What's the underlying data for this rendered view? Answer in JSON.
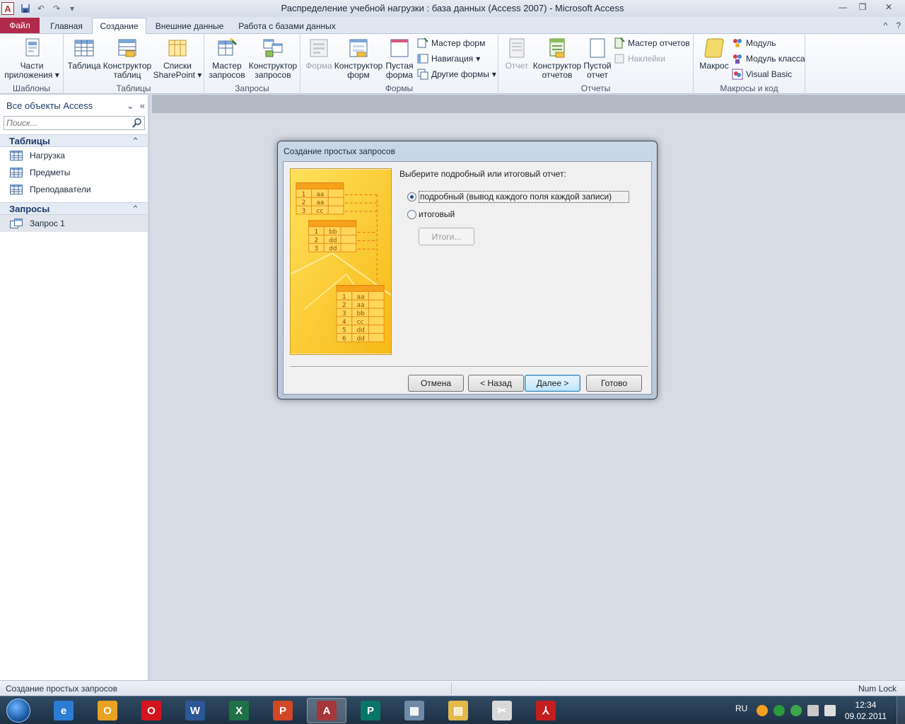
{
  "window": {
    "title": "Распределение учебной нагрузки : база данных (Access 2007)  -  Microsoft Access",
    "app_icon_letter": "A",
    "minimize_glyph": "—",
    "restore_glyph": "❐",
    "close_glyph": "✕"
  },
  "qat": {
    "save_icon": "save-icon",
    "undo_glyph": "↶",
    "redo_glyph": "↷",
    "customize_glyph": "▾"
  },
  "tabs": {
    "file": "Файл",
    "items": [
      "Главная",
      "Создание",
      "Внешние данные",
      "Работа с базами данных"
    ],
    "active_index": 1,
    "help_glyph": "?",
    "minimize_ribbon_glyph": "^"
  },
  "ribbon": {
    "groups": {
      "templates": "Шаблоны",
      "tables": "Таблицы",
      "queries": "Запросы",
      "forms": "Формы",
      "reports": "Отчеты",
      "macros": "Макросы и код"
    },
    "buttons": {
      "app_parts_1": "Части",
      "app_parts_2": "приложения",
      "table": "Таблица",
      "table_design_1": "Конструктор",
      "table_design_2": "таблиц",
      "sharepoint_1": "Списки",
      "sharepoint_2": "SharePoint",
      "query_wizard_1": "Мастер",
      "query_wizard_2": "запросов",
      "query_design_1": "Конструктор",
      "query_design_2": "запросов",
      "form": "Форма",
      "form_design_1": "Конструктор",
      "form_design_2": "форм",
      "blank_form_1": "Пустая",
      "blank_form_2": "форма",
      "form_wizard": "Мастер форм",
      "navigation": "Навигация",
      "more_forms": "Другие формы",
      "report": "Отчет",
      "report_design_1": "Конструктор",
      "report_design_2": "отчетов",
      "blank_report_1": "Пустой",
      "blank_report_2": "отчет",
      "report_wizard": "Мастер отчетов",
      "labels": "Наклейки",
      "macro": "Макрос",
      "module": "Модуль",
      "class_module": "Модуль класса",
      "visual_basic": "Visual Basic"
    }
  },
  "nav": {
    "header": "Все объекты Access",
    "search_placeholder": "Поиск...",
    "sections": [
      {
        "title": "Таблицы",
        "items": [
          "Нагрузка",
          "Предметы",
          "Преподаватели"
        ]
      },
      {
        "title": "Запросы",
        "items": [
          "Запрос 1"
        ]
      }
    ]
  },
  "dialog": {
    "title": "Создание простых запросов",
    "prompt": "Выберите подробный или итоговый отчет:",
    "option_detail": "подробный (вывод каждого поля каждой записи)",
    "option_summary": "итоговый",
    "selected_option": "detail",
    "totals_button": "Итоги...",
    "buttons": {
      "cancel": "Отмена",
      "back": "< Назад",
      "next": "Далее >",
      "finish": "Готово"
    },
    "illustration": {
      "table_top": [
        [
          "1",
          "aa"
        ],
        [
          "2",
          "aa"
        ],
        [
          "3",
          "cc"
        ]
      ],
      "table_mid": [
        [
          "1",
          "bb"
        ],
        [
          "2",
          "dd"
        ],
        [
          "3",
          "dd"
        ]
      ],
      "table_result": [
        [
          "1",
          "aa"
        ],
        [
          "2",
          "aa"
        ],
        [
          "3",
          "bb"
        ],
        [
          "4",
          "cc"
        ],
        [
          "5",
          "dd"
        ],
        [
          "6",
          "dd"
        ]
      ]
    }
  },
  "status": {
    "left": "Создание простых запросов",
    "right": "Num Lock"
  },
  "taskbar": {
    "language": "RU",
    "time": "12:34",
    "date": "09.02.2011",
    "apps": [
      {
        "name": "internet-explorer",
        "letter": "e",
        "color": "#2b7cd3"
      },
      {
        "name": "outlook",
        "letter": "O",
        "color": "#e8a120"
      },
      {
        "name": "opera",
        "letter": "O",
        "color": "#d3141f"
      },
      {
        "name": "word",
        "letter": "W",
        "color": "#2b5797"
      },
      {
        "name": "excel",
        "letter": "X",
        "color": "#1e7145"
      },
      {
        "name": "powerpoint",
        "letter": "P",
        "color": "#d24726"
      },
      {
        "name": "access",
        "letter": "A",
        "color": "#a4373a"
      },
      {
        "name": "publisher",
        "letter": "P",
        "color": "#077568"
      },
      {
        "name": "calculator",
        "letter": "▦",
        "color": "#6d8aa8"
      },
      {
        "name": "explorer",
        "letter": "▤",
        "color": "#e3b94c"
      },
      {
        "name": "tools",
        "letter": "✂",
        "color": "#d8d8d8"
      },
      {
        "name": "acrobat",
        "letter": "⅄",
        "color": "#c41e1e"
      }
    ]
  }
}
